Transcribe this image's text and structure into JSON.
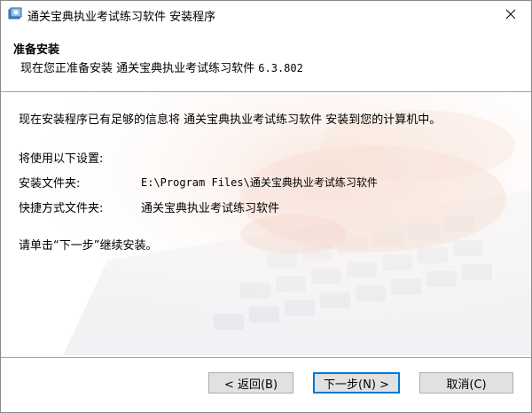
{
  "window": {
    "title": "通关宝典执业考试练习软件 安装程序"
  },
  "header": {
    "title": "准备安装",
    "subtitle_prefix": "现在您正准备安装 通关宝典执业考试练习软件",
    "version": "6.3.802"
  },
  "body": {
    "intro": "现在安装程序已有足够的信息将 通关宝典执业考试练习软件 安装到您的计算机中。",
    "settings_heading": "将使用以下设置:",
    "install_folder_label": "安装文件夹:",
    "install_folder_value": "E:\\Program Files\\通关宝典执业考试练习软件",
    "shortcut_folder_label": "快捷方式文件夹:",
    "shortcut_folder_value": "通关宝典执业考试练习软件",
    "continue_hint": "请单击“下一步”继续安装。"
  },
  "buttons": {
    "back": "< 返回(B)",
    "next": "下一步(N) >",
    "cancel": "取消(C)"
  },
  "colors": {
    "accent": "#0078d7",
    "button_bg": "#e1e1e1"
  }
}
